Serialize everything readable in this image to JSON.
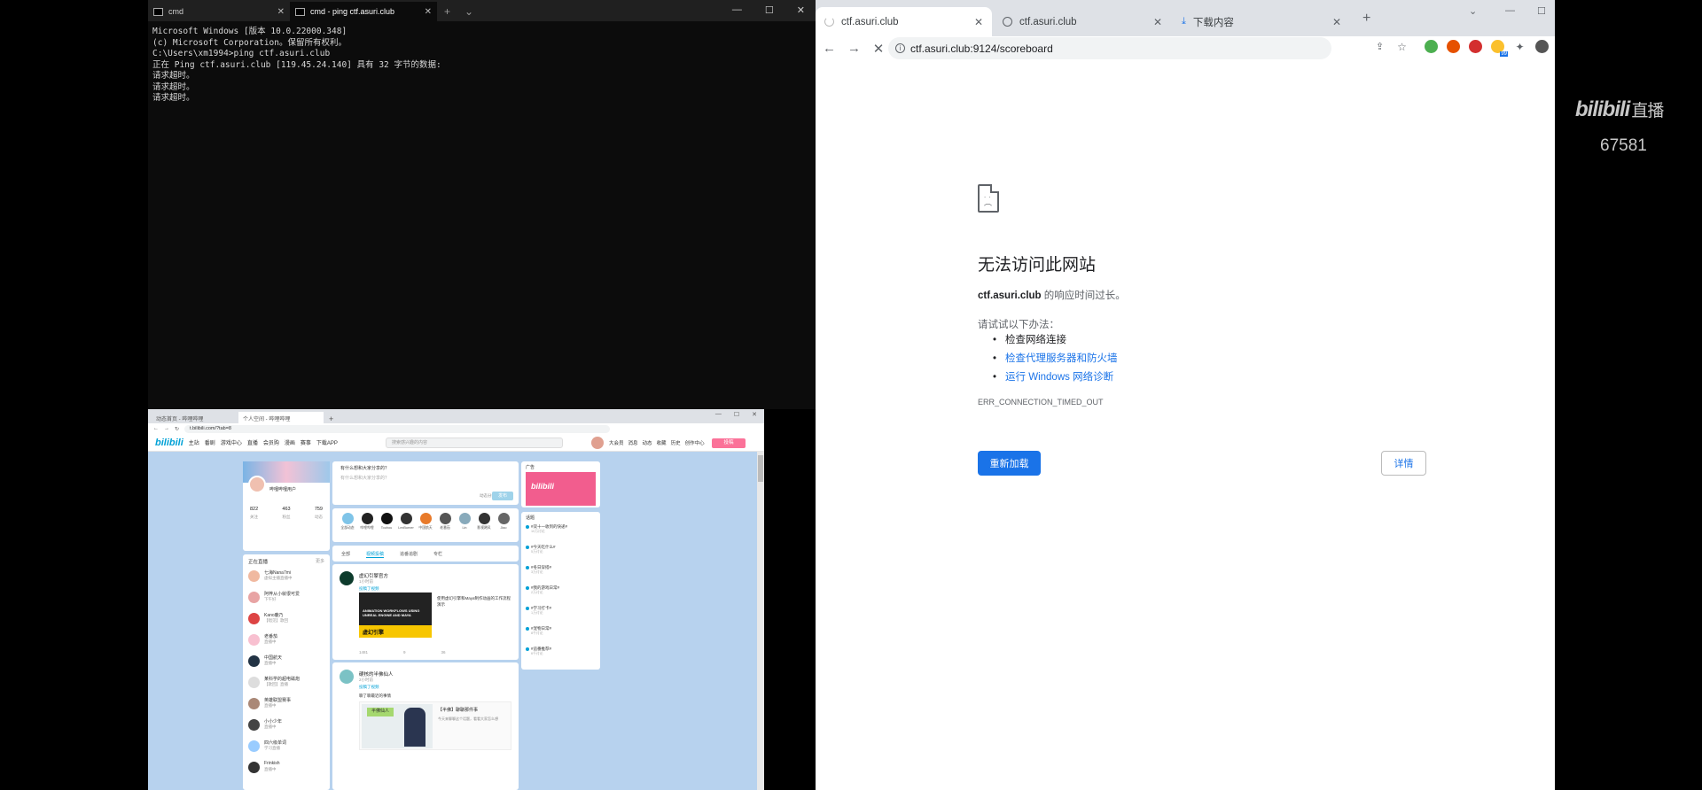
{
  "terminal": {
    "tabs": [
      {
        "label": "cmd"
      },
      {
        "label": "cmd - ping  ctf.asuri.club"
      }
    ],
    "new_tab": "+",
    "dropdown": "⌄",
    "controls": [
      "—",
      "☐",
      "✕"
    ],
    "lines": [
      "Microsoft Windows [版本 10.0.22000.348]",
      "(c) Microsoft Corporation。保留所有权利。",
      "",
      "C:\\Users\\xm1994>ping ctf.asuri.club",
      "",
      "正在 Ping ctf.asuri.club [119.45.24.140] 具有 32 字节的数据:",
      "请求超时。",
      "请求超时。",
      "请求超时。"
    ]
  },
  "chrome": {
    "tabs": [
      {
        "label": "ctf.asuri.club",
        "icon": "loading-spinner"
      },
      {
        "label": "ctf.asuri.club",
        "icon": "globe-icon"
      },
      {
        "label": "下载内容",
        "icon": "download-icon"
      }
    ],
    "new_tab": "+",
    "url": "ctf.asuri.club:9124/scoreboard",
    "extension_badge": "99",
    "error": {
      "title": "无法访问此网站",
      "host": "ctf.asuri.club",
      "host_msg": " 的响应时间过长。",
      "try_label": "请试试以下办法：",
      "suggestions": [
        {
          "text": "检查网络连接",
          "link": false
        },
        {
          "text": "检查代理服务器和防火墙",
          "link": true
        },
        {
          "text": "运行 Windows 网络诊断",
          "link": true
        }
      ],
      "code": "ERR_CONNECTION_TIMED_OUT",
      "reload": "重新加载",
      "details": "详情"
    }
  },
  "watermark": {
    "brand": "bilibili",
    "suffix": "直播",
    "room": "67581"
  },
  "small_browser": {
    "tabs": [
      "动态首页 - 哔哩哔哩",
      "个人空间 - 哔哩哔哩"
    ],
    "url": "t.bilibili.com/?tab=8",
    "logo": "bilibili",
    "nav": [
      "主站",
      "番剧",
      "游戏中心",
      "直播",
      "会员购",
      "漫画",
      "赛事",
      "下载APP"
    ],
    "search_placeholder": "搜索感兴趣的内容",
    "right_nav": [
      "大会员",
      "消息",
      "动态",
      "收藏",
      "历史",
      "创作中心"
    ],
    "post_button": "投稿",
    "profile": {
      "name": "哔哩哔哩用户",
      "stats": [
        "822",
        "463",
        "759"
      ],
      "stat_labels": [
        "关注",
        "粉丝",
        "动态"
      ]
    },
    "live_title": "正在直播",
    "live_more": "更多",
    "live_items": [
      {
        "title": "七海Nana7mi",
        "sub": "虚拟主播直播中",
        "color": "#f0b9a0"
      },
      {
        "title": "阿梓从小就很可爱",
        "sub": "下午好",
        "color": "#e8a4a4"
      },
      {
        "title": "Kano鹿乃",
        "sub": "【唱见】歌回",
        "color": "#d44"
      },
      {
        "title": "老番茄",
        "sub": "直播中",
        "color": "#f8c0d0"
      },
      {
        "title": "中国航天",
        "sub": "直播中",
        "color": "#234"
      },
      {
        "title": "某科学的超电磁炮",
        "sub": "【歌回】直播",
        "color": "#ddd"
      },
      {
        "title": "英雄联盟赛事",
        "sub": "直播中",
        "color": "#a87"
      },
      {
        "title": "小小少年",
        "sub": "直播中",
        "color": "#444"
      },
      {
        "title": "四六级单词",
        "sub": "学习直播",
        "color": "#9cf"
      },
      {
        "title": "Frinkish",
        "sub": "直播中",
        "color": "#333"
      }
    ],
    "composer": {
      "placeholder": "有什么想和大家分享的？",
      "group": "动态分组",
      "send": "发布"
    },
    "ups": [
      "全部动态",
      "哔哩哔哩",
      "Touhou",
      "LexBurner",
      "中国航天",
      "老番茄",
      "Lin",
      "影视飓风",
      "Jiao"
    ],
    "feed_tabs": [
      "全部",
      "视频投稿",
      "追番追剧",
      "专栏"
    ],
    "post1": {
      "name": "虚幻引擎官方",
      "time": "1小时前",
      "tag": "投稿了视频",
      "thumb_text": "ANIMATION WORKFLOWS USING UNREAL ENGINE AND MAYA",
      "thumb_banner": "虚幻引擎",
      "text": "使用虚幻引擎和Maya制作动画的工作流程演示",
      "acts": [
        "1481",
        "9",
        "36"
      ]
    },
    "post2": {
      "name": "硬核的半佛仙人",
      "time": "2小时前",
      "tag": "投稿了视频",
      "line": "聊了聊最近的事情",
      "thumb_label": "半佛仙人",
      "title": "【半佛】聊聊那件事",
      "desc": "今天来聊聊这个话题，看看大家怎么想"
    },
    "ad_title": "广告",
    "ad_banner": "bilibili",
    "topics_title": "话题",
    "topics": [
      {
        "title": "#双十一收到的快递#",
        "sub": "10万讨论"
      },
      {
        "title": "#今天吃什么#",
        "sub": "5万讨论"
      },
      {
        "title": "#冬日穿搭#",
        "sub": "3万讨论"
      },
      {
        "title": "#我的游戏日常#",
        "sub": "2万讨论"
      },
      {
        "title": "#学习打卡#",
        "sub": "1万讨论"
      },
      {
        "title": "#宠物日常#",
        "sub": "8千讨论"
      },
      {
        "title": "#追番推荐#",
        "sub": "6千讨论"
      }
    ]
  }
}
